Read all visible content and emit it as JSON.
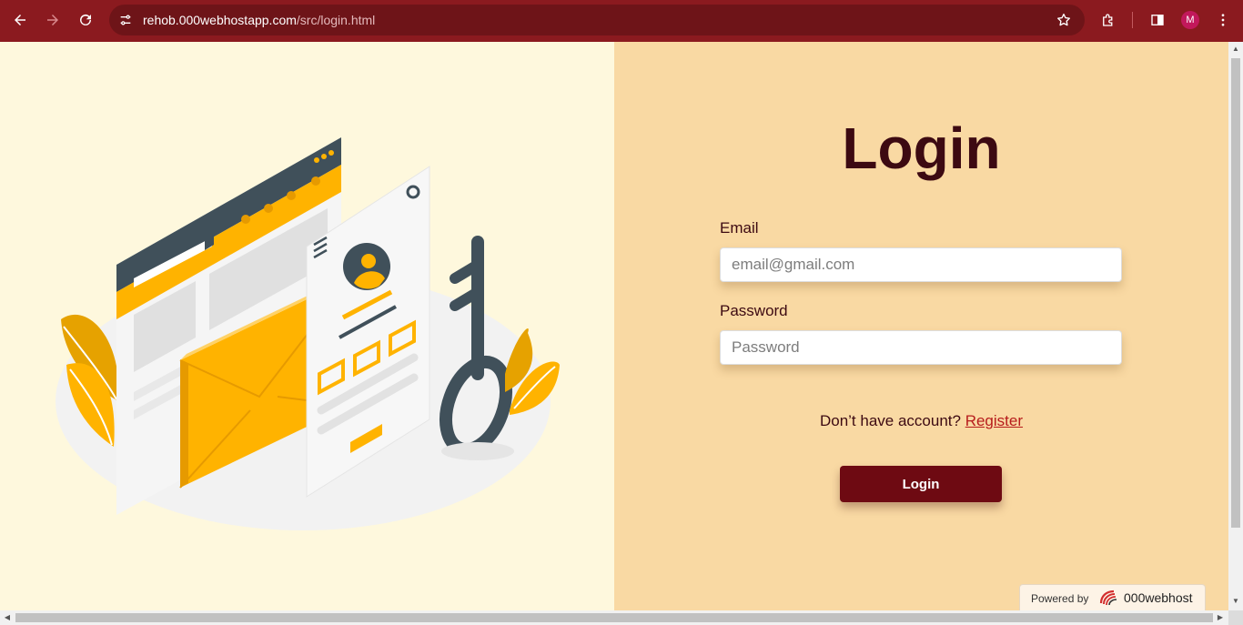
{
  "browser": {
    "url_host": "rehob.000webhostapp.com",
    "url_path": "/src/login.html",
    "profile_initial": "M",
    "icons": [
      "back-arrow-icon",
      "forward-arrow-icon",
      "reload-icon",
      "site-info-icon",
      "bookmark-star-icon",
      "extensions-icon",
      "side-panel-icon",
      "kebab-menu-icon"
    ]
  },
  "login": {
    "title": "Login",
    "email_label": "Email",
    "email_placeholder": "email@gmail.com",
    "password_label": "Password",
    "password_placeholder": "Password",
    "register_prompt": "Don’t have account?",
    "register_link": "Register",
    "submit_label": "Login"
  },
  "footer": {
    "powered_by": "Powered by",
    "brand": "000webhost"
  },
  "colors": {
    "chrome_bar": "#8b1a1f",
    "left_panel": "#fef8dd",
    "right_panel": "#f9d9a3",
    "title": "#3d0a12",
    "button": "#6e0a12",
    "link": "#b71c1c",
    "accent_orange": "#ffae00"
  }
}
